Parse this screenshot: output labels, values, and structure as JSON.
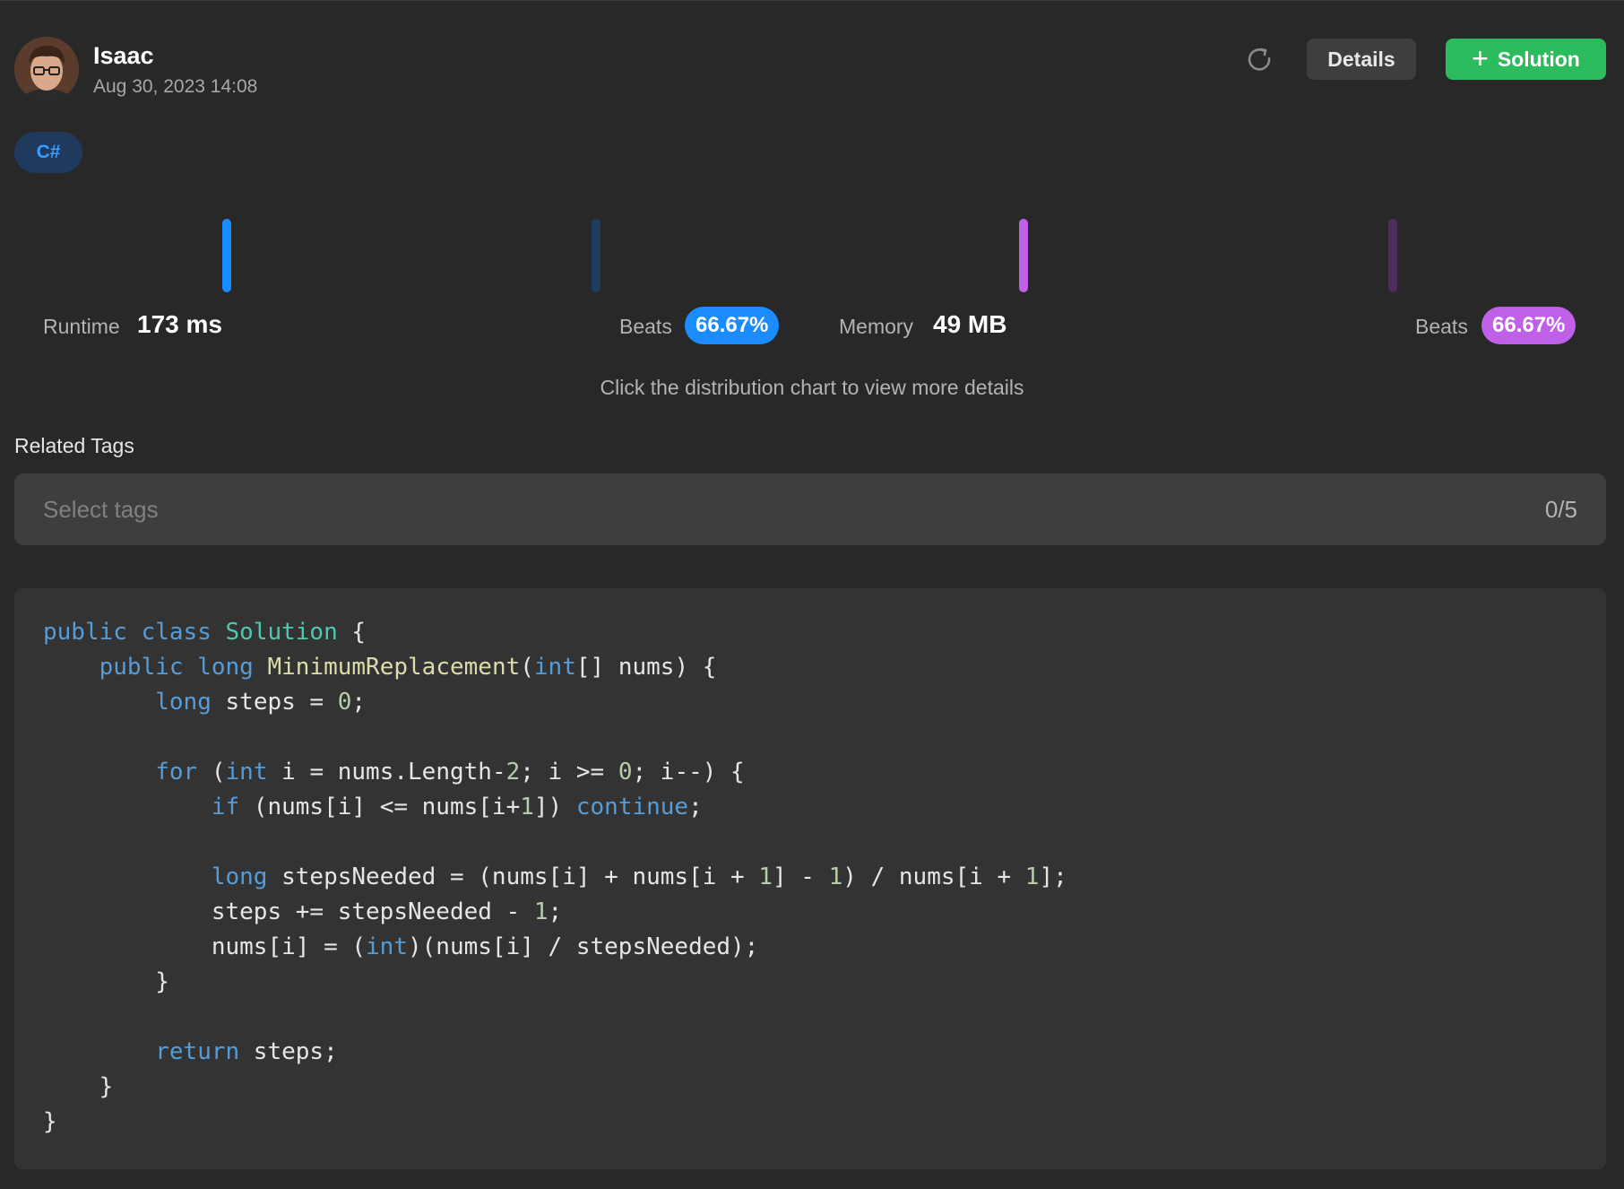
{
  "user": {
    "name": "Isaac",
    "submitted_at": "Aug 30, 2023 14:08"
  },
  "header": {
    "details_label": "Details",
    "solution_label": "Solution"
  },
  "language": "C#",
  "runtime": {
    "label": "Runtime",
    "value": "173 ms",
    "beats_label": "Beats",
    "beats": "66.67%",
    "color": "#1a8cff"
  },
  "memory": {
    "label": "Memory",
    "value": "49 MB",
    "beats_label": "Beats",
    "beats": "66.67%",
    "color": "#c060e8"
  },
  "hint": "Click the distribution chart to view more details",
  "related_tags": {
    "label": "Related Tags",
    "placeholder": "Select tags",
    "count": "0/5"
  },
  "code": [
    [
      [
        "kw",
        "public"
      ],
      [
        "pl",
        " "
      ],
      [
        "kw",
        "class"
      ],
      [
        "pl",
        " "
      ],
      [
        "cls",
        "Solution"
      ],
      [
        "pl",
        " {"
      ]
    ],
    [
      [
        "pl",
        "    "
      ],
      [
        "kw",
        "public"
      ],
      [
        "pl",
        " "
      ],
      [
        "kw",
        "long"
      ],
      [
        "pl",
        " "
      ],
      [
        "fn",
        "MinimumReplacement"
      ],
      [
        "pl",
        "("
      ],
      [
        "kw",
        "int"
      ],
      [
        "pl",
        "[] nums) {"
      ]
    ],
    [
      [
        "pl",
        "        "
      ],
      [
        "kw",
        "long"
      ],
      [
        "pl",
        " steps = "
      ],
      [
        "num",
        "0"
      ],
      [
        "pl",
        ";"
      ]
    ],
    [
      [
        "pl",
        ""
      ]
    ],
    [
      [
        "pl",
        "        "
      ],
      [
        "kw",
        "for"
      ],
      [
        "pl",
        " ("
      ],
      [
        "kw",
        "int"
      ],
      [
        "pl",
        " i = nums.Length-"
      ],
      [
        "num",
        "2"
      ],
      [
        "pl",
        "; i >= "
      ],
      [
        "num",
        "0"
      ],
      [
        "pl",
        "; i--) {"
      ]
    ],
    [
      [
        "pl",
        "            "
      ],
      [
        "kw",
        "if"
      ],
      [
        "pl",
        " (nums[i] <= nums[i+"
      ],
      [
        "num",
        "1"
      ],
      [
        "pl",
        "]) "
      ],
      [
        "kw",
        "continue"
      ],
      [
        "pl",
        ";"
      ]
    ],
    [
      [
        "pl",
        ""
      ]
    ],
    [
      [
        "pl",
        "            "
      ],
      [
        "kw",
        "long"
      ],
      [
        "pl",
        " stepsNeeded = (nums[i] + nums[i + "
      ],
      [
        "num",
        "1"
      ],
      [
        "pl",
        "] - "
      ],
      [
        "num",
        "1"
      ],
      [
        "pl",
        ") / nums[i + "
      ],
      [
        "num",
        "1"
      ],
      [
        "pl",
        "];"
      ]
    ],
    [
      [
        "pl",
        "            steps += stepsNeeded - "
      ],
      [
        "num",
        "1"
      ],
      [
        "pl",
        ";"
      ]
    ],
    [
      [
        "pl",
        "            nums[i] = ("
      ],
      [
        "kw",
        "int"
      ],
      [
        "pl",
        ")(nums[i] / stepsNeeded);"
      ]
    ],
    [
      [
        "pl",
        "        }"
      ]
    ],
    [
      [
        "pl",
        ""
      ]
    ],
    [
      [
        "pl",
        "        "
      ],
      [
        "kw",
        "return"
      ],
      [
        "pl",
        " steps;"
      ]
    ],
    [
      [
        "pl",
        "    }"
      ]
    ],
    [
      [
        "pl",
        "}"
      ]
    ]
  ]
}
